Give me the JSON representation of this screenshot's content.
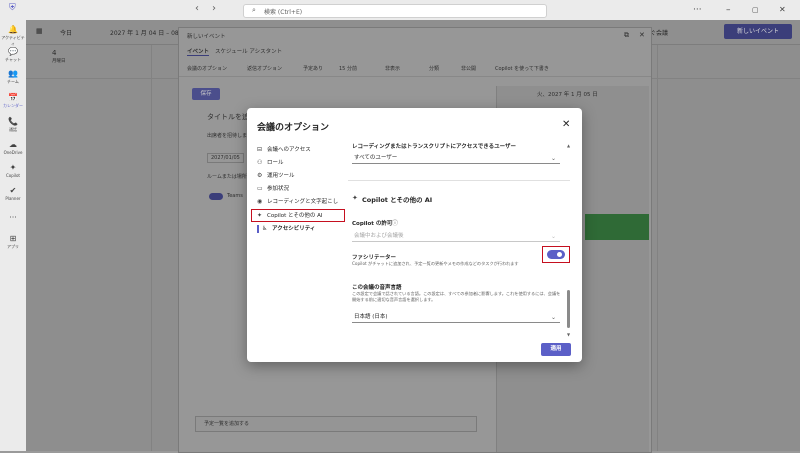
{
  "titlebar": {
    "search_placeholder": "検索 (Ctrl+E)",
    "back_glyph": "‹",
    "forward_glyph": "›",
    "more_glyph": "···",
    "min_glyph": "–",
    "max_glyph": "▢",
    "close_glyph": "✕"
  },
  "rail": {
    "items": [
      {
        "label": "アクティビティ",
        "icon": "bell-icon",
        "glyph": "🔔"
      },
      {
        "label": "チャット",
        "icon": "chat-icon",
        "glyph": "💬"
      },
      {
        "label": "チーム",
        "icon": "teams-icon",
        "glyph": "👥"
      },
      {
        "label": "カレンダー",
        "icon": "calendar-icon",
        "glyph": "📅"
      },
      {
        "label": "通話",
        "icon": "phone-icon",
        "glyph": "📞"
      },
      {
        "label": "OneDrive",
        "icon": "cloud-icon",
        "glyph": "☁"
      },
      {
        "label": "Copilot",
        "icon": "copilot-icon",
        "glyph": "✦"
      },
      {
        "label": "Planner",
        "icon": "planner-icon",
        "glyph": "✔"
      },
      {
        "label": "",
        "icon": "more-icon",
        "glyph": "···"
      },
      {
        "label": "アプリ",
        "icon": "apps-icon",
        "glyph": "⊞"
      }
    ]
  },
  "calendar": {
    "today_label": "今日",
    "date_range": "2027 年 1 月 04 日 – 08 日",
    "day_number": "4",
    "day_name": "月曜日",
    "meet_now": "今すぐ会議",
    "new_event": "新しいイベント"
  },
  "editor": {
    "window_title": "新しいイベント",
    "tabs": [
      "イベント",
      "スケジュール アシスタント"
    ],
    "toolbar": [
      "会議のオプション",
      "返信オプション",
      "予定あり",
      "15 分前",
      "非表示",
      "分類",
      "非公開",
      "Copilot を使って下書き"
    ],
    "save": "保存",
    "title_placeholder": "タイトルを追加",
    "attendees_placeholder": "出席者を招待します",
    "date_value": "2027/01/05",
    "location_placeholder": "ルームまたは場所を追加",
    "teams_label": "Teams",
    "agenda_placeholder": "予定一覧を追加する",
    "side_date": "火、2027 年 1 月 05 日"
  },
  "dialog": {
    "title": "会議のオプション",
    "nav": [
      {
        "label": "会議へのアクセス",
        "icon": "door-icon",
        "glyph": "⊟"
      },
      {
        "label": "ロール",
        "icon": "person-icon",
        "glyph": "⚇"
      },
      {
        "label": "運用ツール",
        "icon": "tools-icon",
        "glyph": "⚙"
      },
      {
        "label": "参加状況",
        "icon": "chat-bubble-icon",
        "glyph": "▭"
      },
      {
        "label": "レコーディングと文字起こし",
        "icon": "record-icon",
        "glyph": "◉"
      },
      {
        "label": "Copilot とその他の AI",
        "icon": "copilot-icon",
        "glyph": "✦"
      },
      {
        "label": "アクセシビリティ",
        "icon": "accessibility-icon",
        "glyph": "♿"
      }
    ],
    "recording_access_label": "レコーディングまたはトランスクリプトにアクセスできるユーザー",
    "recording_access_value": "すべてのユーザー",
    "section_title": "Copilot とその他の AI",
    "copilot_permission_label": "Copilot の許可",
    "copilot_permission_value": "会議中および会議後",
    "facilitator_label": "ファシリテーター",
    "facilitator_hint": "Copilot がチャットに追加され、予定一覧の更新やメモの作成などのタスクが行われます",
    "facilitator_on": true,
    "language_label": "この会議の音声言語",
    "language_hint": "この設定で会議で話されている言語。この設定は、すべての参加者に影響します。これを使用するには、会議を開始する前に適切な音声言語を選択します。",
    "language_value": "日本語 (日本)",
    "apply": "適用"
  },
  "colors": {
    "accent": "#5b5fc7",
    "highlight_box": "#c50f1f",
    "event_green": "#2f6a36"
  }
}
